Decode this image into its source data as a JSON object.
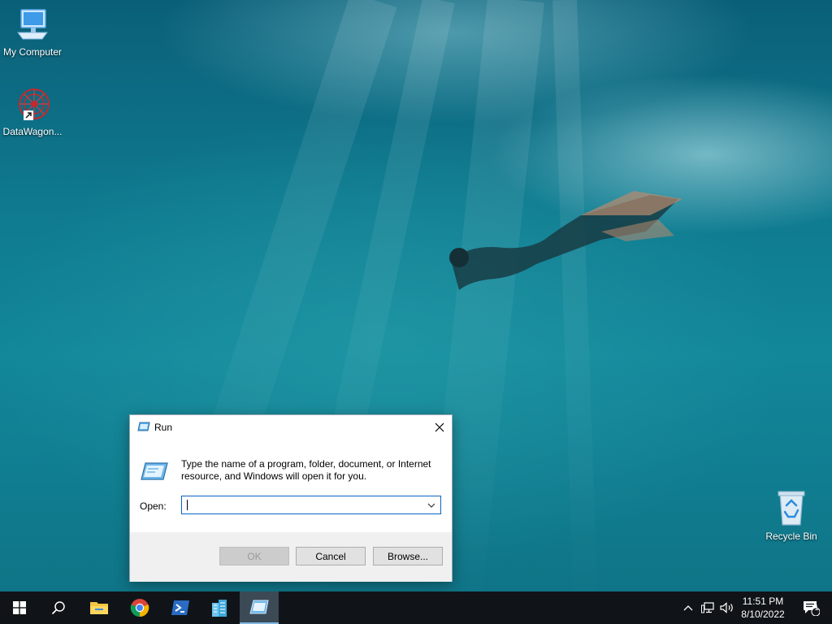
{
  "desktop": {
    "icons": [
      {
        "label": "My Computer",
        "icon": "computer-icon"
      },
      {
        "label": "DataWagon...",
        "icon": "datawagon-icon"
      },
      {
        "label": "Recycle Bin",
        "icon": "recycle-bin-icon"
      }
    ]
  },
  "run_dialog": {
    "title": "Run",
    "description": "Type the name of a program, folder, document, or Internet resource, and Windows will open it for you.",
    "open_label": "Open:",
    "open_value": "",
    "buttons": {
      "ok": "OK",
      "cancel": "Cancel",
      "browse": "Browse..."
    },
    "ok_disabled": true
  },
  "taskbar": {
    "apps": [
      {
        "name": "start",
        "icon": "windows-logo-icon"
      },
      {
        "name": "search",
        "icon": "search-icon"
      },
      {
        "name": "file-explorer",
        "icon": "folder-icon"
      },
      {
        "name": "chrome",
        "icon": "chrome-icon"
      },
      {
        "name": "powershell",
        "icon": "powershell-icon"
      },
      {
        "name": "server-manager",
        "icon": "building-icon"
      },
      {
        "name": "run",
        "icon": "run-icon",
        "active": true
      }
    ],
    "tray": {
      "time": "11:51 PM",
      "date": "8/10/2022",
      "notification_count": "1"
    }
  },
  "colors": {
    "taskbar": "#101418",
    "dialog_footer": "#f0f0f0",
    "input_focus_border": "#0a64c4"
  }
}
